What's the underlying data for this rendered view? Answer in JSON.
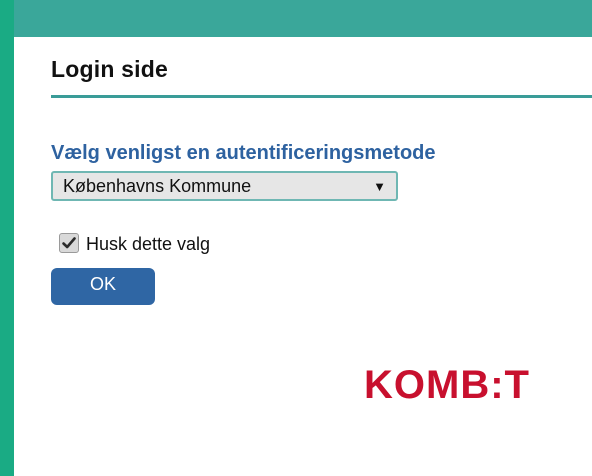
{
  "header": {
    "title": "Login side"
  },
  "auth": {
    "prompt": "Vælg venligst en autentificeringsmetode",
    "select": {
      "selected": "Københavns Kommune",
      "arrow": "▼"
    },
    "remember": {
      "label": "Husk dette valg",
      "checked": true
    },
    "ok_label": "OK"
  },
  "logo": {
    "text": "KOMB:T",
    "color": "#c8102e"
  },
  "colors": {
    "background": "#1aab84",
    "topbar": "#3aa79a",
    "divider": "#3a9c98",
    "prompt": "#2e62a0",
    "button": "#2f66a4"
  }
}
